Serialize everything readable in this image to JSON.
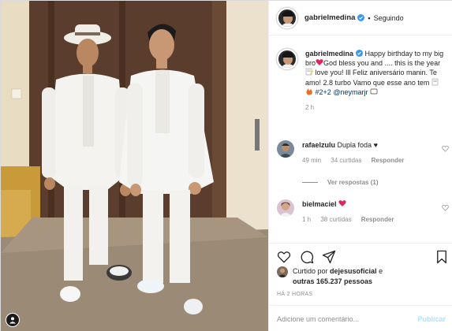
{
  "post": {
    "author": "gabrielmedina",
    "follow_status": "Seguindo",
    "separator": "•",
    "caption": {
      "username": "gabrielmedina",
      "line1": "Happy birthday to my big bro",
      "line2": "God bless you and .... this is the year ",
      "line3": " love you! Ill Feliz aniversário manin. Te amo! 2.8 turbo Vamo que esse ano tem ",
      "hashtag": "#2+2",
      "mention": "@neymarjr",
      "time": "2 h"
    },
    "comments": [
      {
        "username": "rafaelzulu",
        "text": "Dupla foda ♥",
        "time": "49 min",
        "likes": "34 curtidas",
        "reply": "Responder"
      },
      {
        "username": "bielmaciel",
        "text": "",
        "time": "1 h",
        "likes": "38 curtidas",
        "reply": "Responder"
      }
    ],
    "view_replies": "Ver respostas (1)",
    "likes": {
      "prefix": "Curtido por ",
      "first_user": "dejesusoficial",
      "middle": " e",
      "others": "outras 165.237 pessoas"
    },
    "posted_ago": "HÁ 2 HORAS",
    "comment_box": {
      "placeholder": "Adicione um comentário...",
      "publish_label": "Publicar"
    }
  },
  "colors": {
    "verified": "#3897f0",
    "publish": "#b2dffc",
    "link": "#00376b",
    "muted": "#8e8e8e"
  }
}
